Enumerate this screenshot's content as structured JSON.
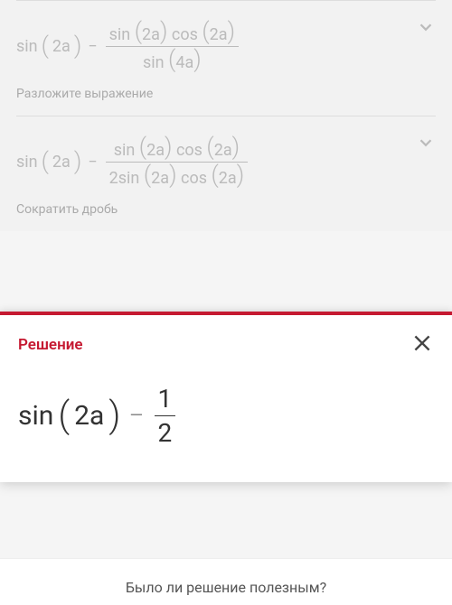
{
  "steps": [
    {
      "prefix_fn": "sin",
      "prefix_arg": "2a",
      "num_left_fn": "sin",
      "num_left_arg": "2a",
      "num_right_fn": "cos",
      "num_right_arg": "2a",
      "den_prefix": "",
      "den_left_fn": "sin",
      "den_left_arg": "4a",
      "den_right_fn": "",
      "den_right_arg": "",
      "hint": "Разложите выражение"
    },
    {
      "prefix_fn": "sin",
      "prefix_arg": "2a",
      "num_left_fn": "sin",
      "num_left_arg": "2a",
      "num_right_fn": "cos",
      "num_right_arg": "2a",
      "den_prefix": "2",
      "den_left_fn": "sin",
      "den_left_arg": "2a",
      "den_right_fn": "cos",
      "den_right_arg": "2a",
      "hint": "Сократить дробь"
    }
  ],
  "solution": {
    "title": "Решение",
    "fn": "sin",
    "arg": "2a",
    "frac_num": "1",
    "frac_den": "2"
  },
  "feedback": {
    "question": "Было ли решение полезным?"
  }
}
